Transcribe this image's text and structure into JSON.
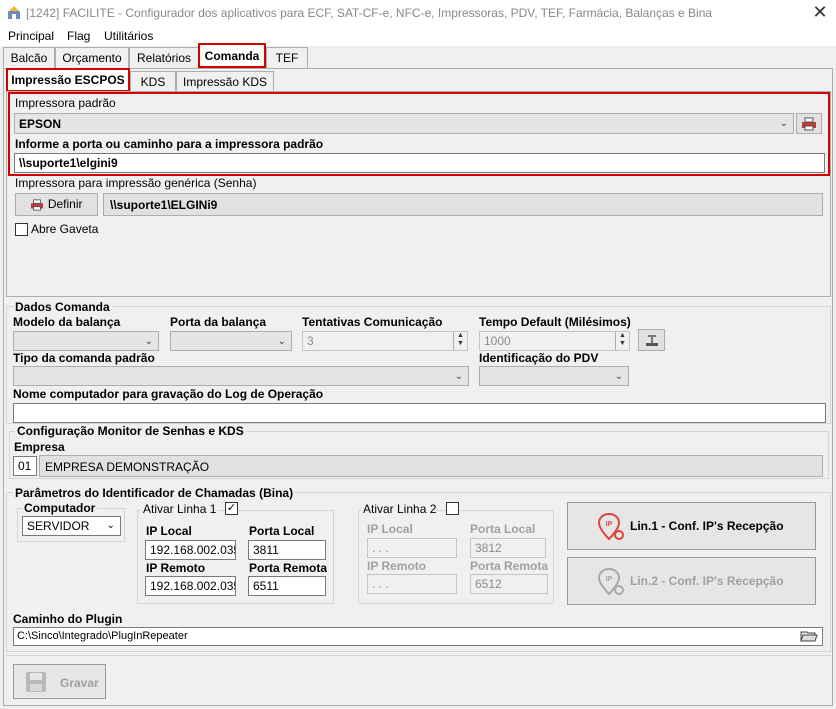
{
  "window": {
    "title": "[1242] FACILITE - Configurador dos aplicativos para ECF, SAT-CF-e, NFC-e, Impressoras, PDV, TEF, Farmácia, Balanças e Bina",
    "close_glyph": "✕"
  },
  "menu": [
    "Principal",
    "Flag",
    "Utilitários"
  ],
  "main_tabs": [
    "Balcão",
    "Orçamento",
    "Relatórios",
    "Comanda",
    "TEF"
  ],
  "sub_tabs": [
    "Impressão ESCPOS",
    "KDS",
    "Impressão KDS"
  ],
  "escpos": {
    "printer_label": "Impressora padrão",
    "printer_value": "EPSON",
    "port_label": "Informe a porta ou caminho para a impressora padrão",
    "port_value": "\\\\suporte1\\elgini9",
    "generic_label": "Impressora para impressão genérica (Senha)",
    "define_button": "Definir",
    "generic_value": "\\\\suporte1\\ELGINi9",
    "drawer_label": "Abre Gaveta"
  },
  "dados": {
    "group_title": "Dados Comanda",
    "scale_model_label": "Modelo da balança",
    "scale_port_label": "Porta da balança",
    "attempts_label": "Tentativas Comunicação",
    "attempts_value": "3",
    "timeout_label": "Tempo Default (Milésimos)",
    "timeout_value": "1000",
    "type_label": "Tipo da comanda padrão",
    "pdv_label": "Identificação do PDV",
    "log_label": "Nome computador para gravação do Log de Operação",
    "log_value": ""
  },
  "monitor": {
    "group_title": "Configuração Monitor de Senhas e KDS",
    "company_label": "Empresa",
    "company_code": "01",
    "company_name": "EMPRESA DEMONSTRAÇÃO"
  },
  "bina": {
    "group_title": "Parâmetros do Identificador de Chamadas (Bina)",
    "computer_label": "Computador",
    "computer_value": "SERVIDOR",
    "line1_label": "Ativar Linha 1",
    "line1_checked": "✓",
    "line2_label": "Ativar Linha 2",
    "ip_local_label": "IP Local",
    "port_local_label": "Porta Local",
    "ip_remote_label": "IP Remoto",
    "port_remote_label": "Porta Remota",
    "l1_ip_local": "192.168.002.035",
    "l1_port_local": "3811",
    "l1_ip_remote": "192.168.002.035",
    "l1_port_remote": "6511",
    "l2_ip_local": "   .   .   .",
    "l2_port_local": "3812",
    "l2_ip_remote": "   .   .   .",
    "l2_port_remote": "6512",
    "btn_line1": "Lin.1 - Conf. IP's Recepção",
    "btn_line2": "Lin.2 - Conf. IP's Recepção"
  },
  "plugin": {
    "label": "Caminho do Plugin",
    "value": "C:\\Sinco\\Integrado\\PlugInRepeater"
  },
  "save_button": "Gravar",
  "colors": {
    "highlight": "#d40000",
    "icon_red": "#e0453a"
  }
}
